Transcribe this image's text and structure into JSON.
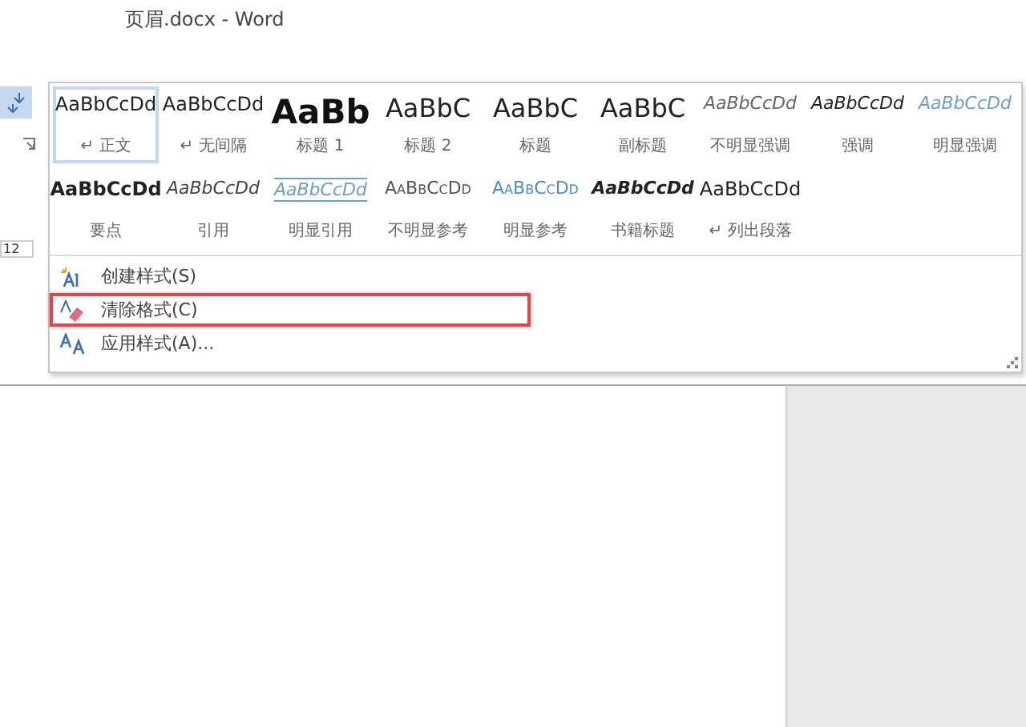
{
  "window": {
    "title": "页眉.docx - Word"
  },
  "ribbon": {
    "font_size": "12"
  },
  "style_gallery": {
    "items": [
      {
        "sample": "AaBbCcDd",
        "label": "↵ 正文",
        "kind": "normal",
        "selected": true
      },
      {
        "sample": "AaBbCcDd",
        "label": "↵ 无间隔",
        "kind": "normal",
        "selected": false
      },
      {
        "sample": "AaBb",
        "label": "标题 1",
        "kind": "heading1",
        "selected": false
      },
      {
        "sample": "AaBbC",
        "label": "标题 2",
        "kind": "heading2",
        "selected": false
      },
      {
        "sample": "AaBbC",
        "label": "标题",
        "kind": "title",
        "selected": false
      },
      {
        "sample": "AaBbC",
        "label": "副标题",
        "kind": "subtitle",
        "selected": false
      },
      {
        "sample": "AaBbCcDd",
        "label": "不明显强调",
        "kind": "subtle-emphasis",
        "selected": false
      },
      {
        "sample": "AaBbCcDd",
        "label": "强调",
        "kind": "emphasis",
        "selected": false
      },
      {
        "sample": "AaBbCcDd",
        "label": "明显强调",
        "kind": "intense-emphasis",
        "selected": false
      },
      {
        "sample": "AaBbCcDd",
        "label": "要点",
        "kind": "strong",
        "selected": false
      },
      {
        "sample": "AaBbCcDd",
        "label": "引用",
        "kind": "quote",
        "selected": false
      },
      {
        "sample": "AaBbCcDd",
        "label": "明显引用",
        "kind": "intense-quote",
        "selected": false
      },
      {
        "sample": "AaBbCcDd",
        "label": "不明显参考",
        "kind": "subtle-reference",
        "selected": false
      },
      {
        "sample": "AaBbCcDd",
        "label": "明显参考",
        "kind": "intense-reference",
        "selected": false
      },
      {
        "sample": "AaBbCcDd",
        "label": "书籍标题",
        "kind": "book-title",
        "selected": false
      },
      {
        "sample": "AaBbCcDd",
        "label": "↵ 列出段落",
        "kind": "normal",
        "selected": false
      }
    ]
  },
  "menu": [
    {
      "label": "创建样式(S)",
      "kind": "create",
      "highlighted": false
    },
    {
      "label": "清除格式(C)",
      "kind": "clear",
      "highlighted": true
    },
    {
      "label": "应用样式(A)...",
      "kind": "apply",
      "highlighted": false
    }
  ]
}
